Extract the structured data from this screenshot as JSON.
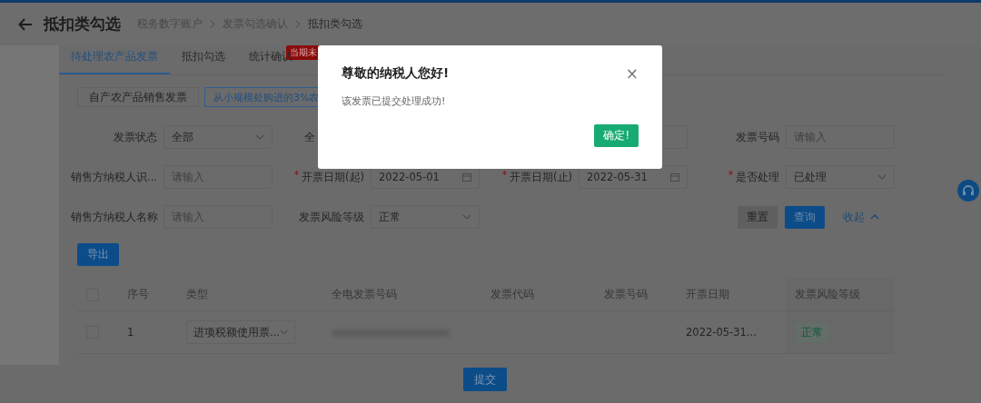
{
  "header": {
    "title": "抵扣类勾选",
    "breadcrumb": [
      "税务数字账户",
      "发票勾选确认",
      "抵扣类勾选"
    ]
  },
  "tabs": [
    {
      "label": "待处理农产品发票",
      "selected": true
    },
    {
      "label": "抵扣勾选",
      "selected": false
    },
    {
      "label": "统计确认",
      "selected": false,
      "badge": "当期未"
    }
  ],
  "segments": [
    {
      "label": "自产农产品销售发票",
      "selected": false
    },
    {
      "label": "从小规模处购进的3%农",
      "selected": true
    }
  ],
  "filters": [
    [
      {
        "label": "发票状态",
        "kind": "select",
        "value": "全部"
      },
      {
        "label": "全",
        "kind": "covered"
      },
      {
        "label": "发票号码",
        "kind": "input",
        "placeholder": "请输入"
      }
    ],
    [
      {
        "label": "销售方纳税人识...",
        "kind": "input",
        "placeholder": "请输入"
      },
      {
        "label": "开票日期(起)",
        "required": true,
        "kind": "date",
        "value": "2022-05-01"
      },
      {
        "label": "开票日期(止)",
        "required": true,
        "kind": "date",
        "value": "2022-05-31"
      },
      {
        "label": "是否处理",
        "required": true,
        "kind": "select",
        "value": "已处理"
      }
    ],
    [
      {
        "label": "销售方纳税人名称",
        "kind": "input",
        "placeholder": "请输入"
      },
      {
        "label": "发票风险等级",
        "kind": "select",
        "value": "正常"
      }
    ]
  ],
  "filter_actions": {
    "reset": "重置",
    "query": "查询",
    "collapse": "收起"
  },
  "export_button": "导出",
  "table": {
    "header_checked": false,
    "columns": [
      "序号",
      "类型",
      "全电发票号码",
      "发票代码",
      "发票号码",
      "开票日期",
      "发票风险等级"
    ],
    "rows": [
      {
        "checked": false,
        "index": "1",
        "type": "进项税额使用票...",
        "date": "2022-05-31...",
        "risk": "正常"
      }
    ]
  },
  "submit_button": "提交",
  "dialog": {
    "title": "尊敬的纳税人您好!",
    "message": "该发票已提交处理成功!",
    "confirm": "确定!",
    "close": "×"
  }
}
